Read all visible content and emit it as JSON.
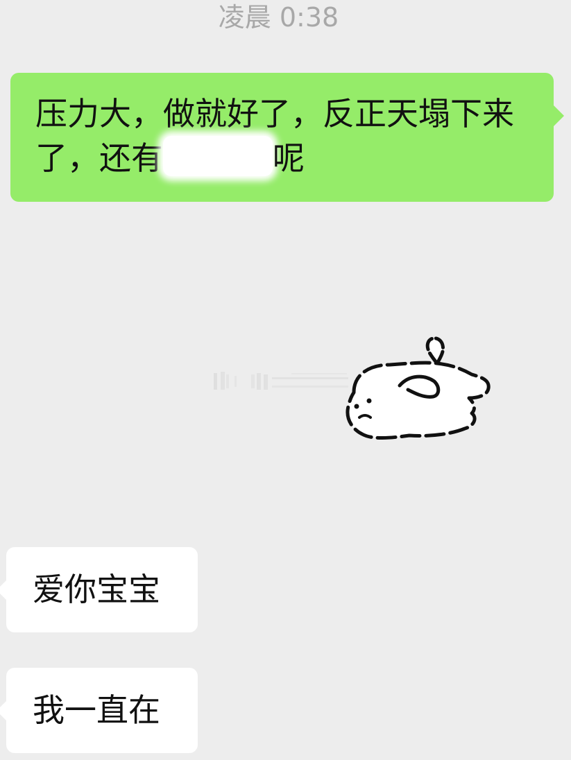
{
  "chat": {
    "timestamp": "凌晨 0:38",
    "messages": [
      {
        "direction": "outgoing",
        "text_before": "压力大，做就好了，反正天塌下来了，还有",
        "text_after": "呢",
        "has_redaction": true
      },
      {
        "direction": "incoming",
        "sticker": "white-bunny-lying-down-sticker"
      },
      {
        "direction": "incoming",
        "text": "爱你宝宝"
      },
      {
        "direction": "incoming",
        "text": "我一直在"
      }
    ]
  },
  "colors": {
    "background": "#ededed",
    "outgoing_bubble": "#95ec69",
    "incoming_bubble": "#ffffff",
    "timestamp_text": "#a8a8a8",
    "message_text": "#111111"
  }
}
